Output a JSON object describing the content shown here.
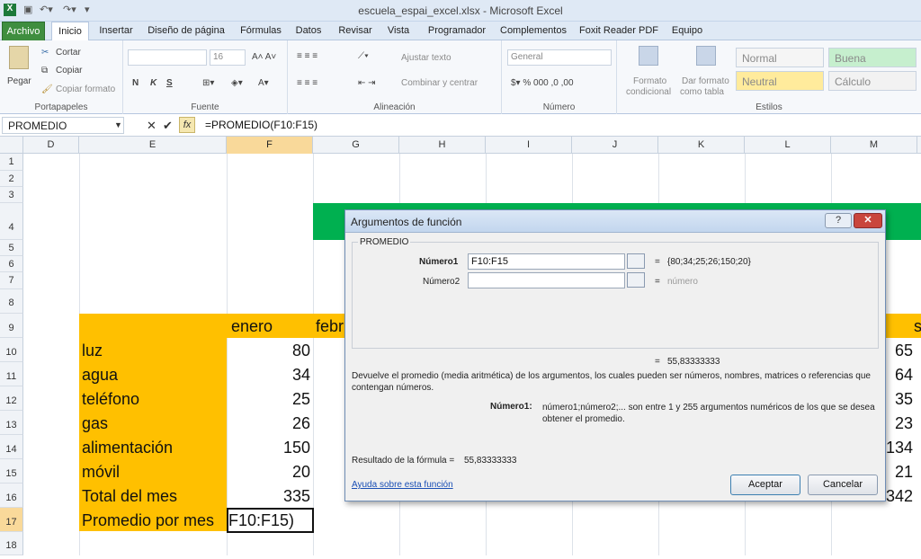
{
  "window": {
    "title": "escuela_espai_excel.xlsx - Microsoft Excel"
  },
  "tabs": [
    "Archivo",
    "Inicio",
    "Insertar",
    "Diseño de página",
    "Fórmulas",
    "Datos",
    "Revisar",
    "Vista",
    "Programador",
    "Complementos",
    "Foxit Reader PDF",
    "Equipo"
  ],
  "ribbon": {
    "clipboard": {
      "paste": "Pegar",
      "cut": "Cortar",
      "copy": "Copiar",
      "format": "Copiar formato",
      "label": "Portapapeles"
    },
    "font": {
      "size": "16",
      "bold": "N",
      "italic": "K",
      "underline": "S",
      "label": "Fuente"
    },
    "alignment": {
      "wrap": "Ajustar texto",
      "merge": "Combinar y centrar",
      "label": "Alineación"
    },
    "number": {
      "format": "General",
      "label": "Número"
    },
    "styles": {
      "cond_a": "Formato",
      "cond_b": "condicional",
      "table_a": "Dar formato",
      "table_b": "como tabla",
      "normal": "Normal",
      "buena": "Buena",
      "neutral": "Neutral",
      "calculo": "Cálculo",
      "label": "Estilos"
    }
  },
  "formula_bar": {
    "name_box": "PROMEDIO",
    "cancel": "✕",
    "enter": "✔",
    "fx": "fx",
    "formula": "=PROMEDIO(F10:F15)"
  },
  "columns": [
    "D",
    "E",
    "F",
    "G",
    "H",
    "I",
    "J",
    "K",
    "L",
    "M"
  ],
  "rows": [
    "1",
    "2",
    "3",
    "4",
    "5",
    "6",
    "7",
    "8",
    "9",
    "10",
    "11",
    "12",
    "13",
    "14",
    "15",
    "16",
    "17",
    "18"
  ],
  "sheet": {
    "header_enero": "enero",
    "header_feb": "febr",
    "header_s": "s",
    "labels": [
      "luz",
      "agua",
      "teléfono",
      "gas",
      "alimentación",
      "móvil",
      "Total del mes",
      "Promedio por mes"
    ],
    "enero": [
      "80",
      "34",
      "25",
      "26",
      "150",
      "20",
      "335"
    ],
    "col_m": [
      "65",
      "64",
      "35",
      "23",
      "134",
      "21",
      "342"
    ],
    "active_cell": "F10:F15)"
  },
  "dialog": {
    "title": "Argumentos de función",
    "function_name": "PROMEDIO",
    "arg1_label": "Número1",
    "arg1_value": "F10:F15",
    "arg1_result": "{80;34;25;26;150;20}",
    "arg2_label": "Número2",
    "arg2_result": "número",
    "equals": "=",
    "result_value": "55,83333333",
    "description": "Devuelve el promedio (media aritmética) de los argumentos, los cuales pueden ser números, nombres, matrices o referencias que contengan números.",
    "arg_help_label": "Número1:",
    "arg_help_text": "número1;número2;... son entre 1 y 255 argumentos numéricos de los que se desea obtener el promedio.",
    "formula_result_label": "Resultado de la fórmula =",
    "formula_result_value": "55,83333333",
    "help_link": "Ayuda sobre esta función",
    "ok": "Aceptar",
    "cancel": "Cancelar",
    "help_btn": "?",
    "close_btn": "✕"
  }
}
